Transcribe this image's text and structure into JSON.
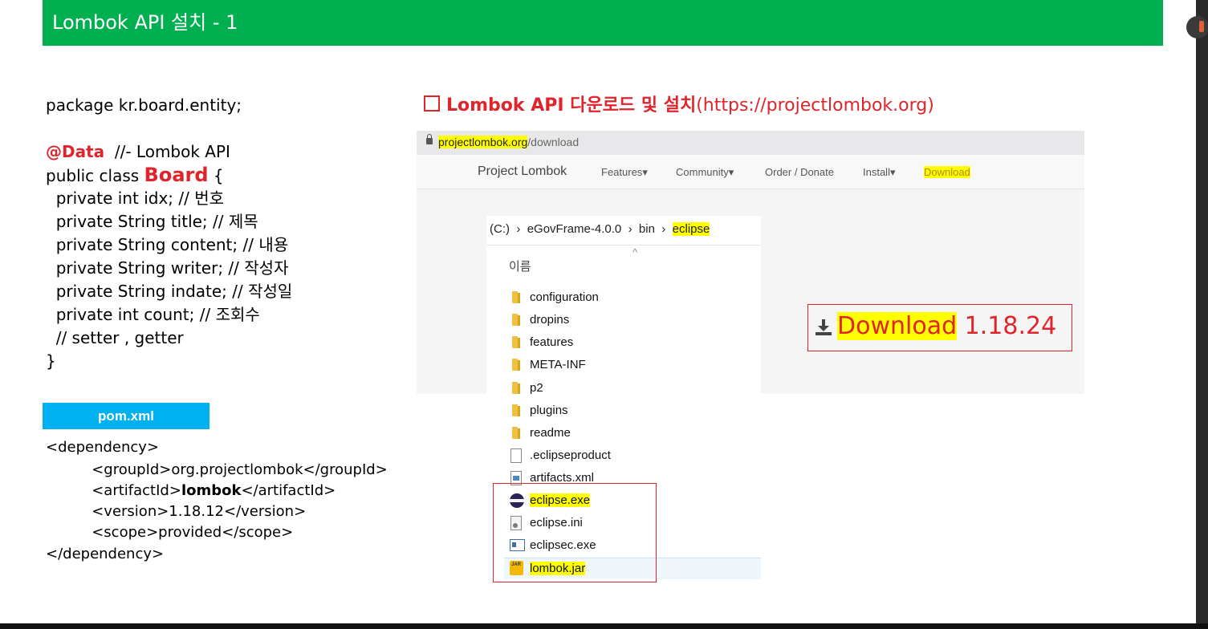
{
  "header": {
    "title": "Lombok API 설치 - 1"
  },
  "code": {
    "package": "package kr.board.entity;",
    "annotation": "@Data",
    "annotation_comment": "  //- Lombok API",
    "class_prefix": "public class ",
    "class_name": "Board",
    "class_suffix": " {",
    "fields": [
      "  private int idx; // 번호",
      "  private String title; // 제목",
      "  private String content; // 내용",
      "  private String writer; // 작성자",
      "  private String indate; // 작성일",
      "  private int count; // 조회수",
      "  // setter , getter"
    ],
    "close": "}"
  },
  "pom": {
    "label": "pom.xml",
    "lines": {
      "open": "<dependency>",
      "group": "          <groupId>org.projectlombok</groupId>",
      "artifact_open": "          <artifactId>",
      "artifact_name": "lombok",
      "artifact_close": "</artifactId>",
      "version": "          <version>1.18.12</version>",
      "scope": "          <scope>provided</scope>",
      "close": "</dependency>"
    }
  },
  "section": {
    "title": "Lombok API 다운로드 및 설치",
    "url": "(https://projectlombok.org)"
  },
  "browser": {
    "url_host": "projectlombok.org",
    "url_path": "/download",
    "brand": "Project Lombok",
    "nav": [
      "Features",
      "Community",
      "Order / Donate",
      "Install",
      "Download"
    ],
    "download_label": "Download",
    "download_version": "1.18.24"
  },
  "explorer": {
    "crumbs": [
      "(C:)",
      "eGovFrame-4.0.0",
      "bin",
      "eclipse"
    ],
    "column": "이름",
    "items": [
      {
        "name": "configuration",
        "type": "folder"
      },
      {
        "name": "dropins",
        "type": "folder"
      },
      {
        "name": "features",
        "type": "folder"
      },
      {
        "name": "META-INF",
        "type": "folder"
      },
      {
        "name": "p2",
        "type": "folder"
      },
      {
        "name": "plugins",
        "type": "folder"
      },
      {
        "name": "readme",
        "type": "folder"
      },
      {
        "name": ".eclipseproduct",
        "type": "file"
      },
      {
        "name": "artifacts.xml",
        "type": "xml"
      },
      {
        "name": "eclipse.exe",
        "type": "exe"
      },
      {
        "name": "eclipse.ini",
        "type": "ini"
      },
      {
        "name": "eclipsec.exe",
        "type": "console"
      },
      {
        "name": "lombok.jar",
        "type": "jar"
      }
    ]
  }
}
